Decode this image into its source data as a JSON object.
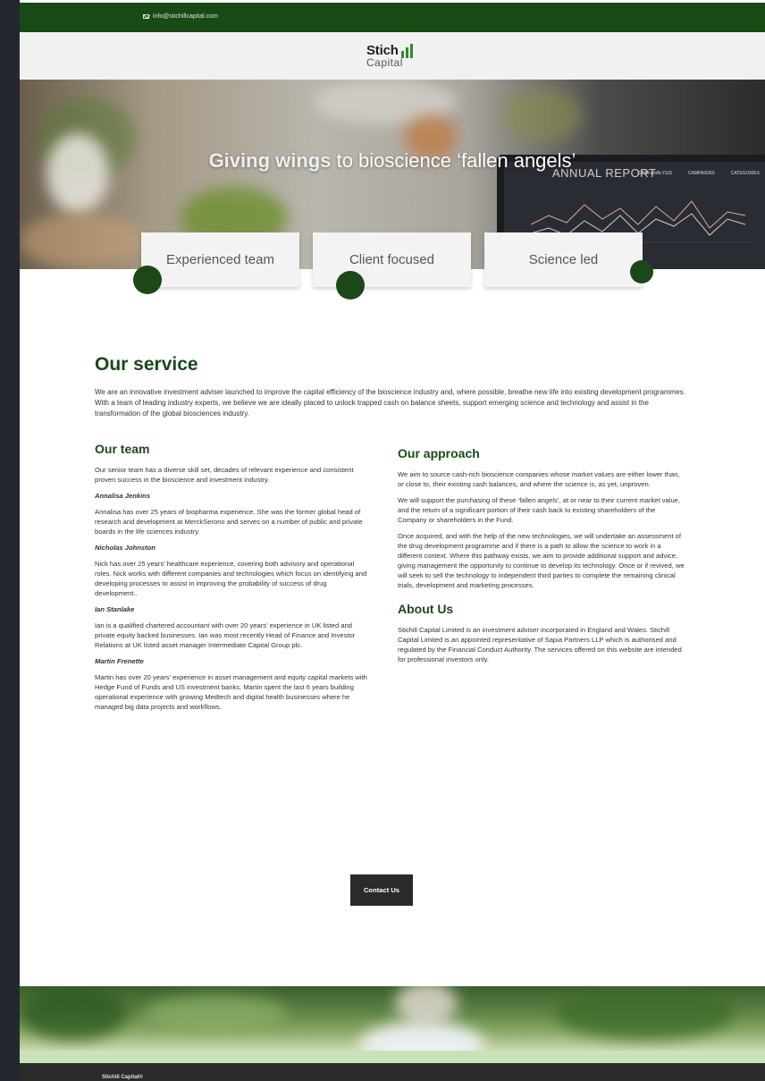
{
  "topbar": {
    "email": "info@stichillcapital.com",
    "email_icon": "mail-icon"
  },
  "logo": {
    "line1": "Stich",
    "line2": "Capital"
  },
  "hero": {
    "title_bold": "Giving wings",
    "title_rest": "to bioscience ‘fallen angels’",
    "laptop_screen_title": "ANNUAL REPORT",
    "laptop_nav": [
      "DATA ANALYSIS",
      "CAMPAIGNS",
      "CATEGORIES"
    ]
  },
  "features": [
    "Experienced team",
    "Client focused",
    "Science led"
  ],
  "service": {
    "title": "Our service",
    "intro": "We are an innovative investment adviser launched to improve the capital efficiency of the bioscience industry and, where possible, breathe new life into existing development programmes. With a team of leading industry experts, we believe we are ideally placed to unlock trapped cash on balance sheets, support emerging science and technology and assist in the transformation of the global biosciences industry."
  },
  "team": {
    "title": "Our team",
    "intro": "Our senior team has a diverse skill set, decades of relevant experience and consistent proven success in the bioscience and investment industry.",
    "members": [
      {
        "name": "Annalisa Jenkins",
        "bio": "Annalisa has over 25 years of biopharma experience. She was the former global head of research and development at MerckSerono and serves on a number of public and private boards in the life sciences industry."
      },
      {
        "name": "Nicholas Johnston",
        "bio": "Nick has over 25 years’ healthcare experience, covering both advisory and operational roles. Nick works with different companies and technologies which focus on identifying and developing processes to assist in improving the probability of success of drug development.."
      },
      {
        "name": "Ian Stanlake",
        "bio": "Ian is a qualified chartered accountant with over 20 years’ experience in UK listed and private equity backed businesses. Ian was most recently Head of Finance and Investor Relations at UK listed asset manager Intermediate Capital Group plc."
      },
      {
        "name": "Martin Frenette",
        "bio": "Martin has over 20 years’ experience in asset management and equity capital markets with Hedge Fund of Funds and US investment banks. Martin spent the last 6 years building operational experience with growing Medtech and digital health businesses where he managed big data projects and workflows."
      }
    ]
  },
  "approach": {
    "title": "Our approach",
    "paragraphs": [
      "We aim to source cash-rich bioscience companies whose market values are either lower than, or close to, their existing cash balances, and where the science is, as yet, unproven.",
      "We will support the purchasing of these ‘fallen angels’, at or near to their current market value, and the return of a significant portion of their cash back to existing shareholders of the Company or shareholders in the Fund.",
      "Once acquired, and with the help of the new technologies, we will undertake an assessment of the drug development programme and if there is a path to allow the science to work in a different context. Where this pathway exists, we aim to provide additional support and advice, giving management the opportunity to continue to develop its technology. Once or if revived, we will seek to sell the technology to independent third parties to complete the remaining clinical trials, development and marketing processes."
    ]
  },
  "about": {
    "title": "About Us",
    "text": "Stichill Capital Limited is an investment adviser incorporated in England and Wales. Stichill Capital Limited is an appointed representative of Sapia Partners LLP which is authorised and regulated by the Financial Conduct Authority. The services offered on this website are intended for professional investors only."
  },
  "cta": {
    "label": "Contact Us"
  },
  "footer": {
    "brand": "Stichill Capital®"
  },
  "colors": {
    "brand_green": "#1a4a17",
    "topbar": "#174a14",
    "dark": "#2a2a2a"
  }
}
